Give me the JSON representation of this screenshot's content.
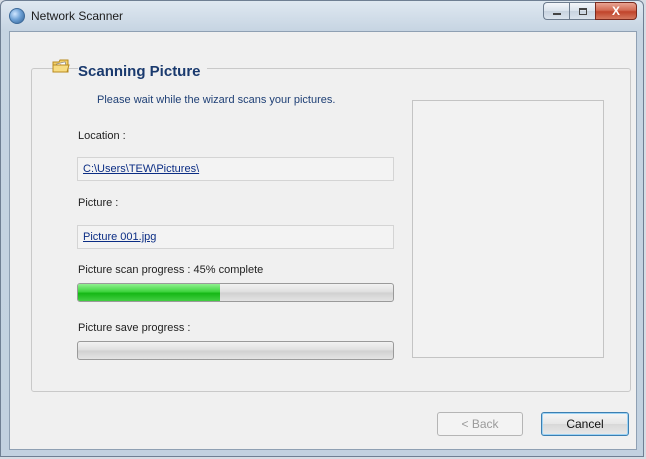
{
  "window": {
    "title": "Network Scanner",
    "caption_buttons": {
      "minimize_icon": "minimize-icon",
      "maximize_icon": "maximize-icon",
      "close_glyph": "X"
    }
  },
  "wizard": {
    "icon": "folder-picture-icon",
    "title": "Scanning Picture",
    "subtitle": "Please wait while the wizard scans your pictures."
  },
  "location": {
    "label": "Location :",
    "value": "C:\\Users\\TEW\\Pictures\\"
  },
  "picture": {
    "label": "Picture :",
    "value": "Picture 001.jpg"
  },
  "scan_progress": {
    "label": "Picture scan progress : 45% complete",
    "percent": 45
  },
  "save_progress": {
    "label": "Picture save progress :",
    "percent": 0
  },
  "buttons": {
    "back": "< Back",
    "cancel": "Cancel"
  },
  "colors": {
    "accent": "#1a3a6e",
    "progress_green": "#16b816",
    "close_red": "#c0442b"
  }
}
